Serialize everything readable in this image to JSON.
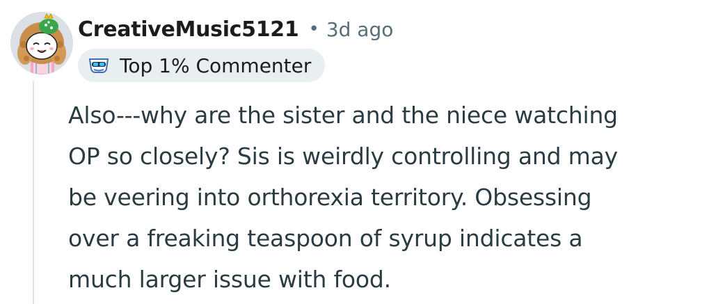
{
  "comment": {
    "author": "CreativeMusic5121",
    "separator": "•",
    "timestamp": "3d ago",
    "avatar_icon": "snoo-avatar-icon",
    "flair": {
      "label": "Top 1% Commenter",
      "icon": "top-commenter-icon"
    },
    "body_lines": [
      "Also---why are the sister and the niece watching",
      "OP so closely? Sis is weirdly controlling and may",
      "be veering into orthorexia territory. Obsessing",
      "over a freaking teaspoon of syrup indicates a",
      "much larger issue with food."
    ]
  }
}
